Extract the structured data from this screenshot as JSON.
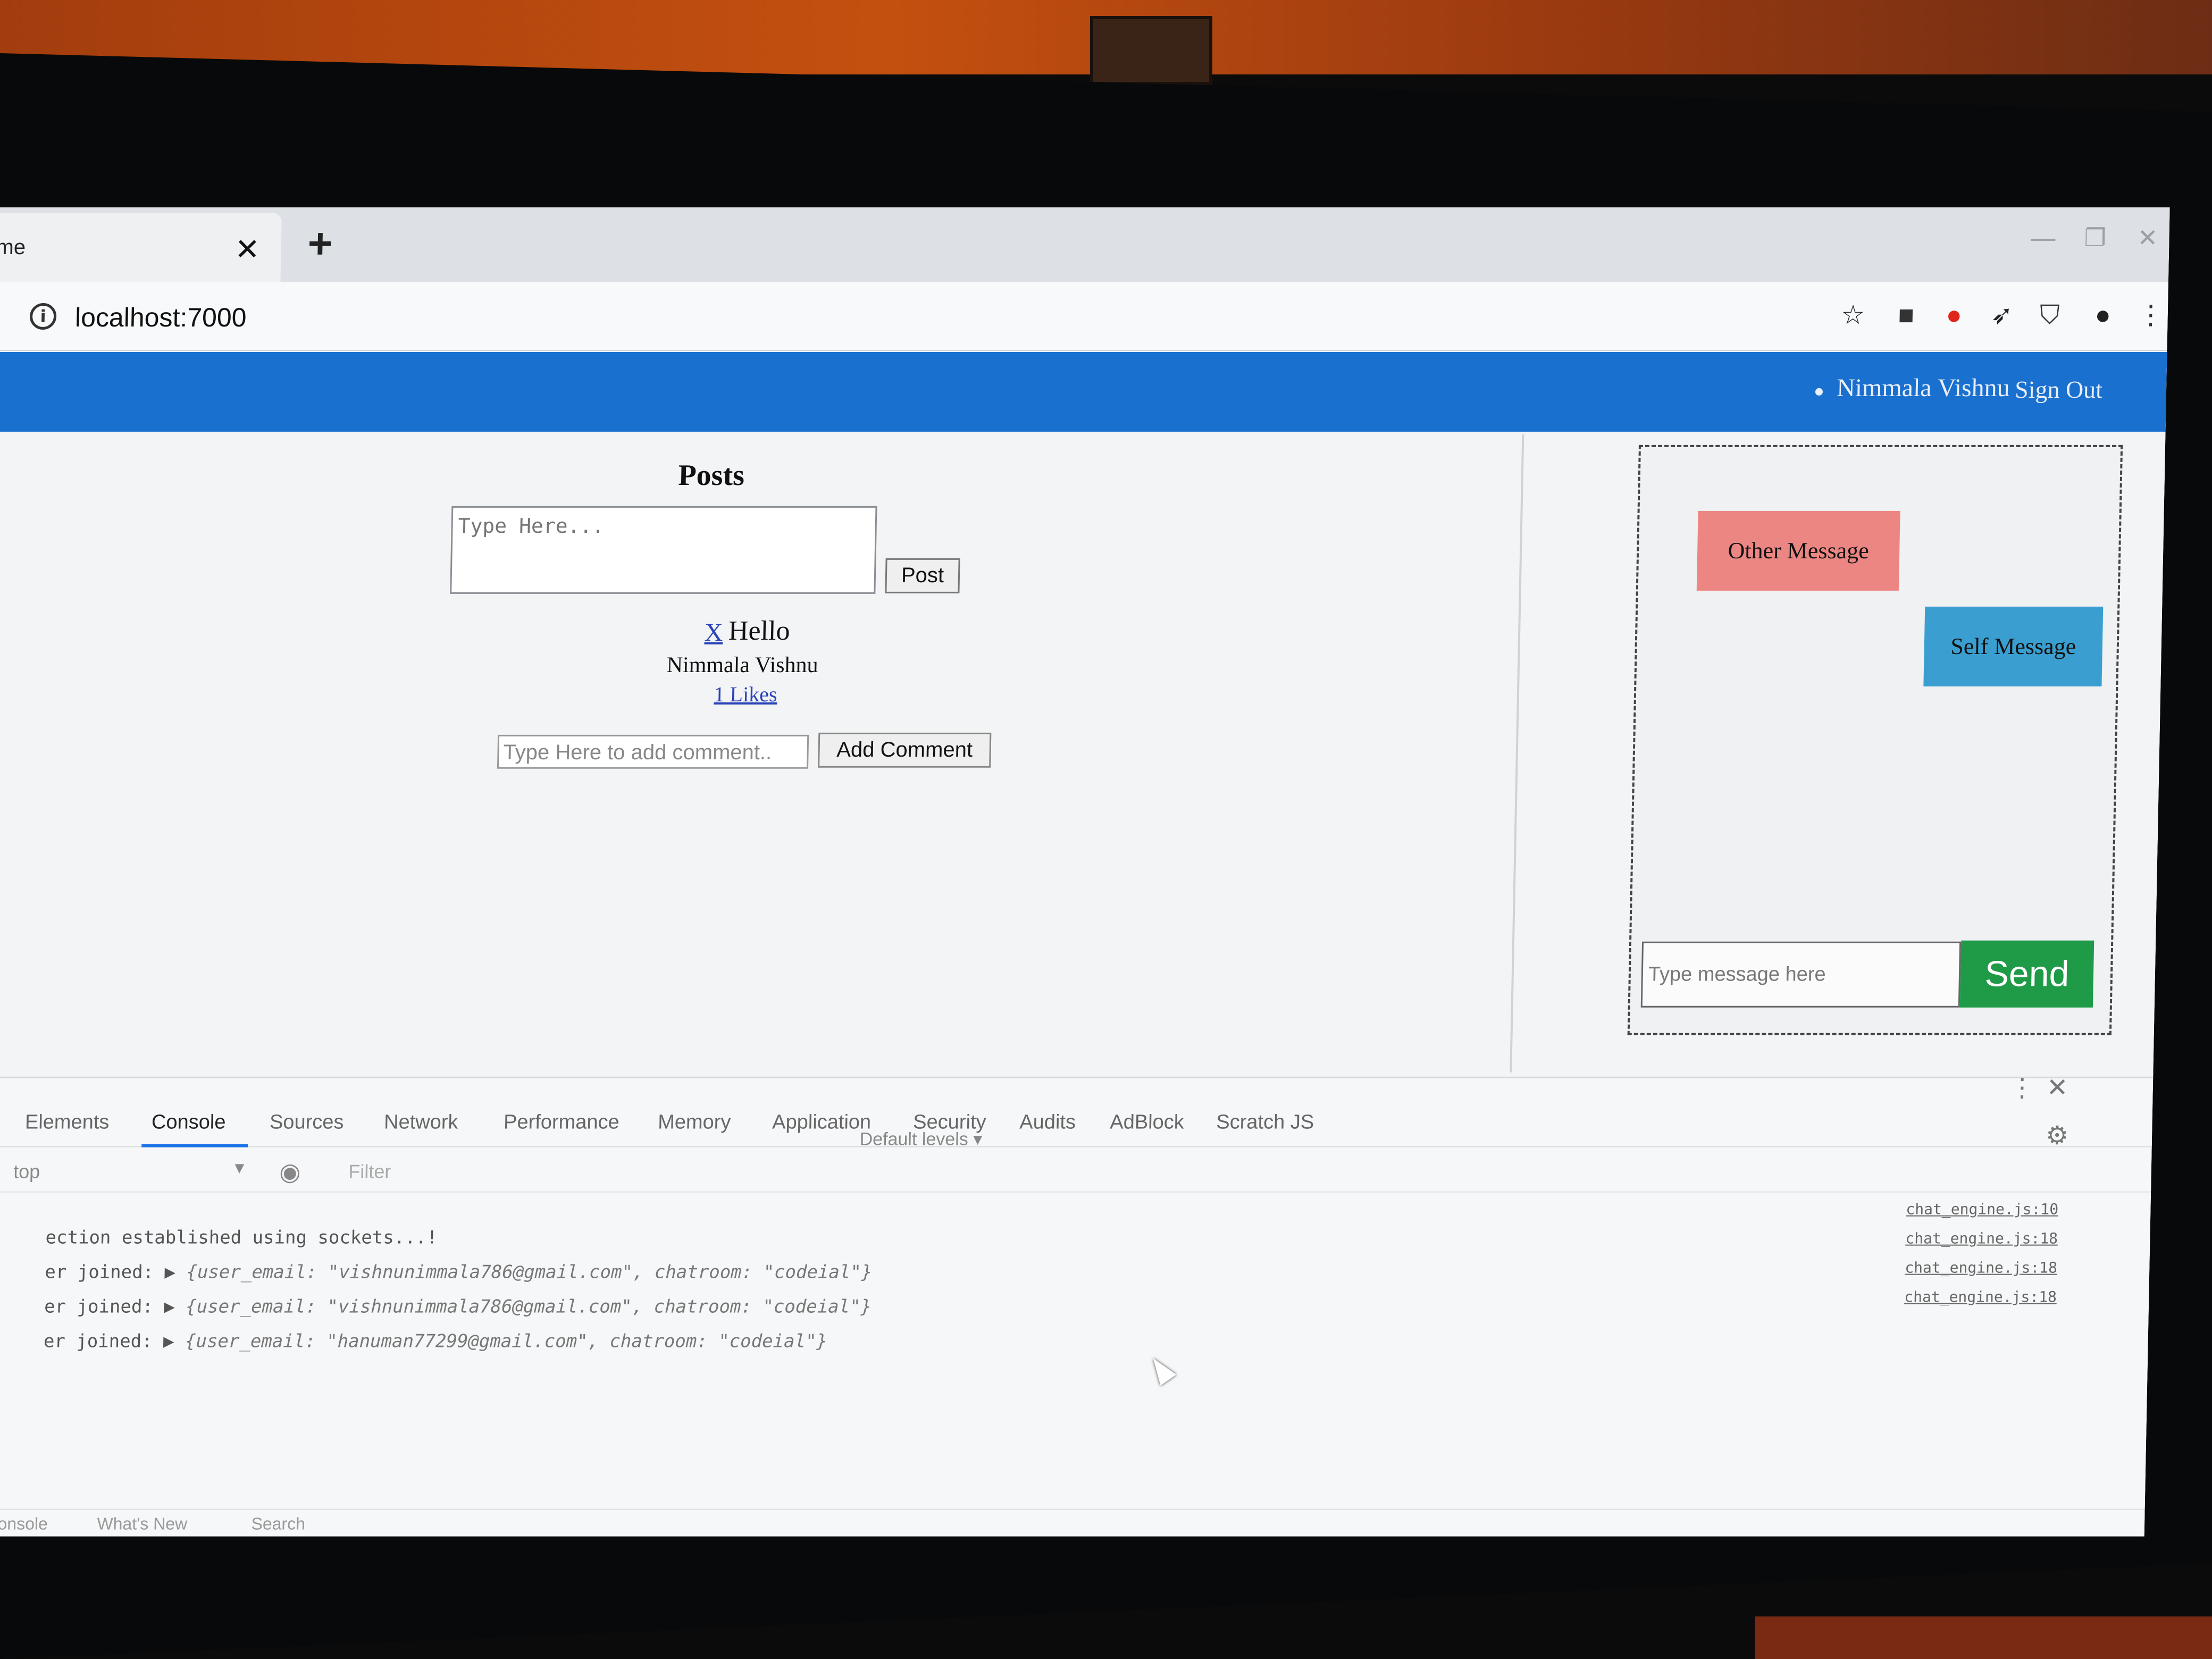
{
  "browser": {
    "tab_title": "me",
    "tab_close": "✕",
    "new_tab": "+",
    "url": "localhost:7000",
    "window_controls": [
      "—",
      "❐",
      "✕"
    ],
    "extensions": [
      "star-icon",
      "square-extension-icon",
      "opera-icon",
      "rocket-icon",
      "pocket-icon",
      "profile-avatar",
      "menu-icon"
    ]
  },
  "navbar": {
    "user_name": "Nimmala Vishnu",
    "sign_out": "Sign Out"
  },
  "posts": {
    "title": "Posts",
    "input_placeholder": "Type Here...",
    "post_button": "Post",
    "items": [
      {
        "delete_label": "X",
        "content": "Hello",
        "author": "Nimmala Vishnu",
        "likes": "1 Likes",
        "comment_placeholder": "Type Here to add comment..",
        "comment_button": "Add Comment"
      }
    ]
  },
  "chat": {
    "messages": [
      {
        "type": "other",
        "text": "Other Message"
      },
      {
        "type": "self",
        "text": "Self Message"
      }
    ],
    "input_placeholder": "Type message here",
    "send_button": "Send"
  },
  "devtools": {
    "tabs": [
      "Elements",
      "Console",
      "Sources",
      "Network",
      "Performance",
      "Memory",
      "Application",
      "Security",
      "Audits",
      "AdBlock",
      "Scratch JS"
    ],
    "active_tab": "Console",
    "context": "top",
    "filter_placeholder": "Filter",
    "levels": "Default levels ▾",
    "logs": [
      {
        "prefix": "ection established using sockets...!",
        "object": ""
      },
      {
        "prefix": "er joined: ▶",
        "object": "{user_email: \"vishnunimmala786@gmail.com\", chatroom: \"codeial\"}"
      },
      {
        "prefix": "er joined: ▶",
        "object": "{user_email: \"vishnunimmala786@gmail.com\", chatroom: \"codeial\"}"
      },
      {
        "prefix": "er joined: ▶",
        "object": "{user_email: \"hanuman77299@gmail.com\", chatroom: \"codeial\"}"
      }
    ],
    "sources": [
      "chat_engine.js:10",
      "chat_engine.js:18",
      "chat_engine.js:18",
      "chat_engine.js:18"
    ],
    "drawer_tabs": [
      "Console",
      "What's New",
      "Search"
    ]
  },
  "colors": {
    "navbar": "#1970cf",
    "other_message": "#ec8683",
    "self_message": "#3a9fd0",
    "send_button": "#1f9a46",
    "link": "#2a43b8"
  }
}
